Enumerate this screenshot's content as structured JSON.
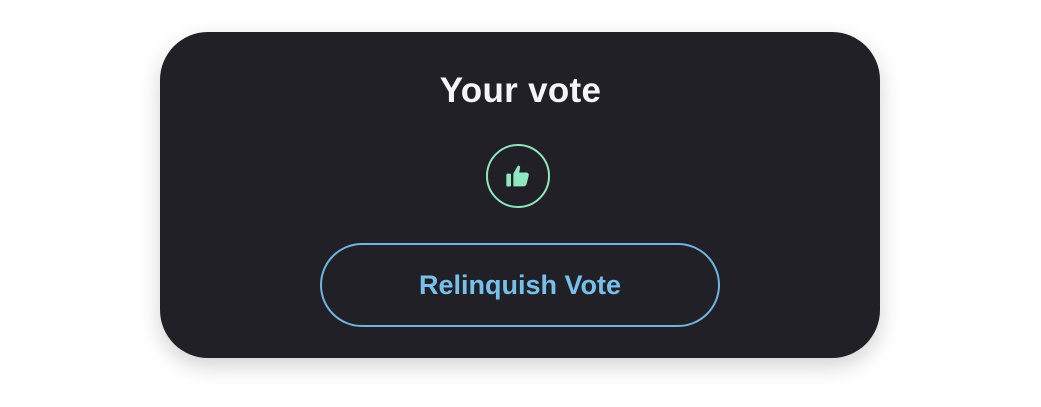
{
  "vote_panel": {
    "title": "Your vote",
    "current_vote_icon": "thumbs-up-icon",
    "relinquish_label": "Relinquish Vote"
  },
  "colors": {
    "background": "#212026",
    "title_text": "#f5f5f7",
    "vote_accent": "#8fe6bf",
    "button_accent": "#78c0ec"
  }
}
